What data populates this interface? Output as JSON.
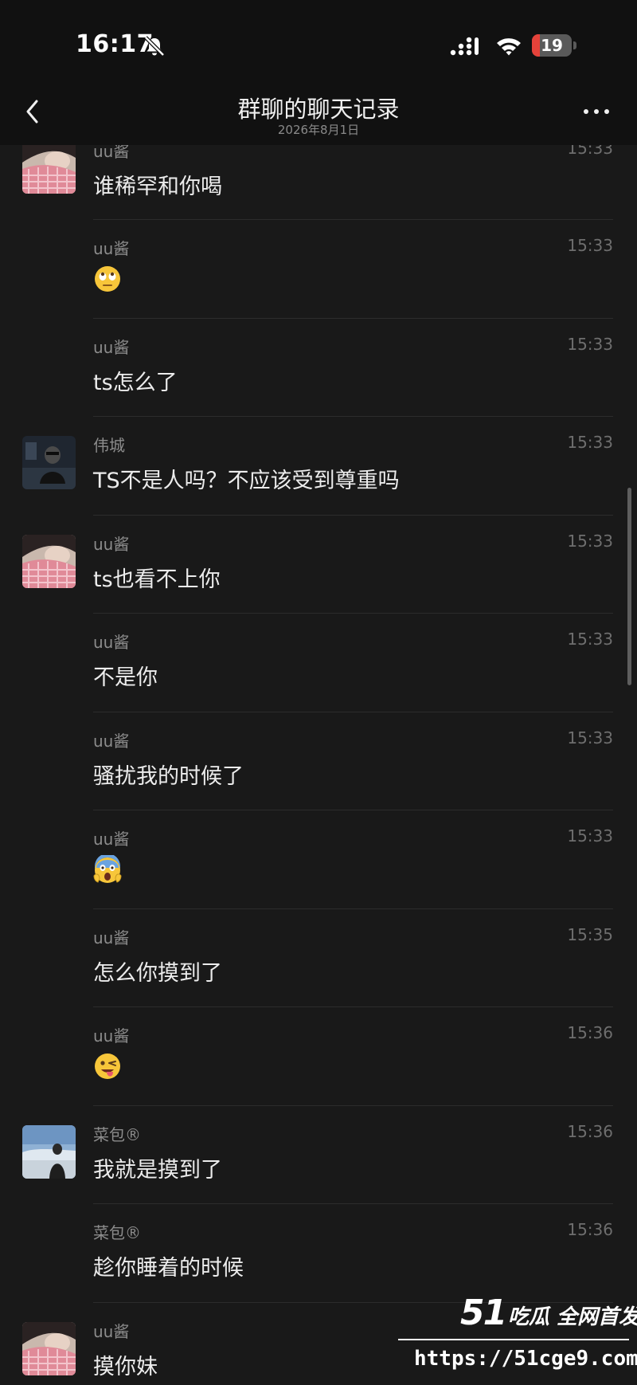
{
  "status_bar": {
    "time": "16:17",
    "battery_level": "19",
    "battery_fraction": 0.19
  },
  "nav": {
    "title": "群聊的聊天记录",
    "subtitle": "2026年8月1日"
  },
  "messages": [
    {
      "sender": "uu酱",
      "time": "15:33",
      "text": "谁稀罕和你喝",
      "avatar": "uu",
      "kind": "text"
    },
    {
      "sender": "uu酱",
      "time": "15:33",
      "emoji": "face-with-rolling-eyes",
      "kind": "emoji"
    },
    {
      "sender": "uu酱",
      "time": "15:33",
      "text": "ts怎么了",
      "kind": "text"
    },
    {
      "sender": "伟城",
      "time": "15:33",
      "text": "TS不是人吗？不应该受到尊重吗",
      "avatar": "weicheng",
      "kind": "text"
    },
    {
      "sender": "uu酱",
      "time": "15:33",
      "text": "ts也看不上你",
      "avatar": "uu",
      "kind": "text"
    },
    {
      "sender": "uu酱",
      "time": "15:33",
      "text": "不是你",
      "kind": "text"
    },
    {
      "sender": "uu酱",
      "time": "15:33",
      "text": "骚扰我的时候了",
      "kind": "text"
    },
    {
      "sender": "uu酱",
      "time": "15:33",
      "emoji": "face-screaming-in-fear",
      "kind": "emoji"
    },
    {
      "sender": "uu酱",
      "time": "15:35",
      "text": "怎么你摸到了",
      "kind": "text"
    },
    {
      "sender": "uu酱",
      "time": "15:36",
      "emoji": "winking-face-with-tongue",
      "kind": "emoji"
    },
    {
      "sender": "菜包®",
      "time": "15:36",
      "text": "我就是摸到了",
      "avatar": "caibao",
      "kind": "text"
    },
    {
      "sender": "菜包®",
      "time": "15:36",
      "text": "趁你睡着的时候",
      "kind": "text"
    },
    {
      "sender": "uu酱",
      "time": "",
      "text": "摸你妹",
      "avatar": "uu",
      "kind": "text"
    }
  ],
  "watermark": {
    "logo_number": "51",
    "logo_text": "吃瓜 全网首发",
    "url": "https://51cge9.com"
  },
  "colors": {
    "background": "#191919",
    "header": "#111111",
    "battery_low": "#e5423a"
  }
}
